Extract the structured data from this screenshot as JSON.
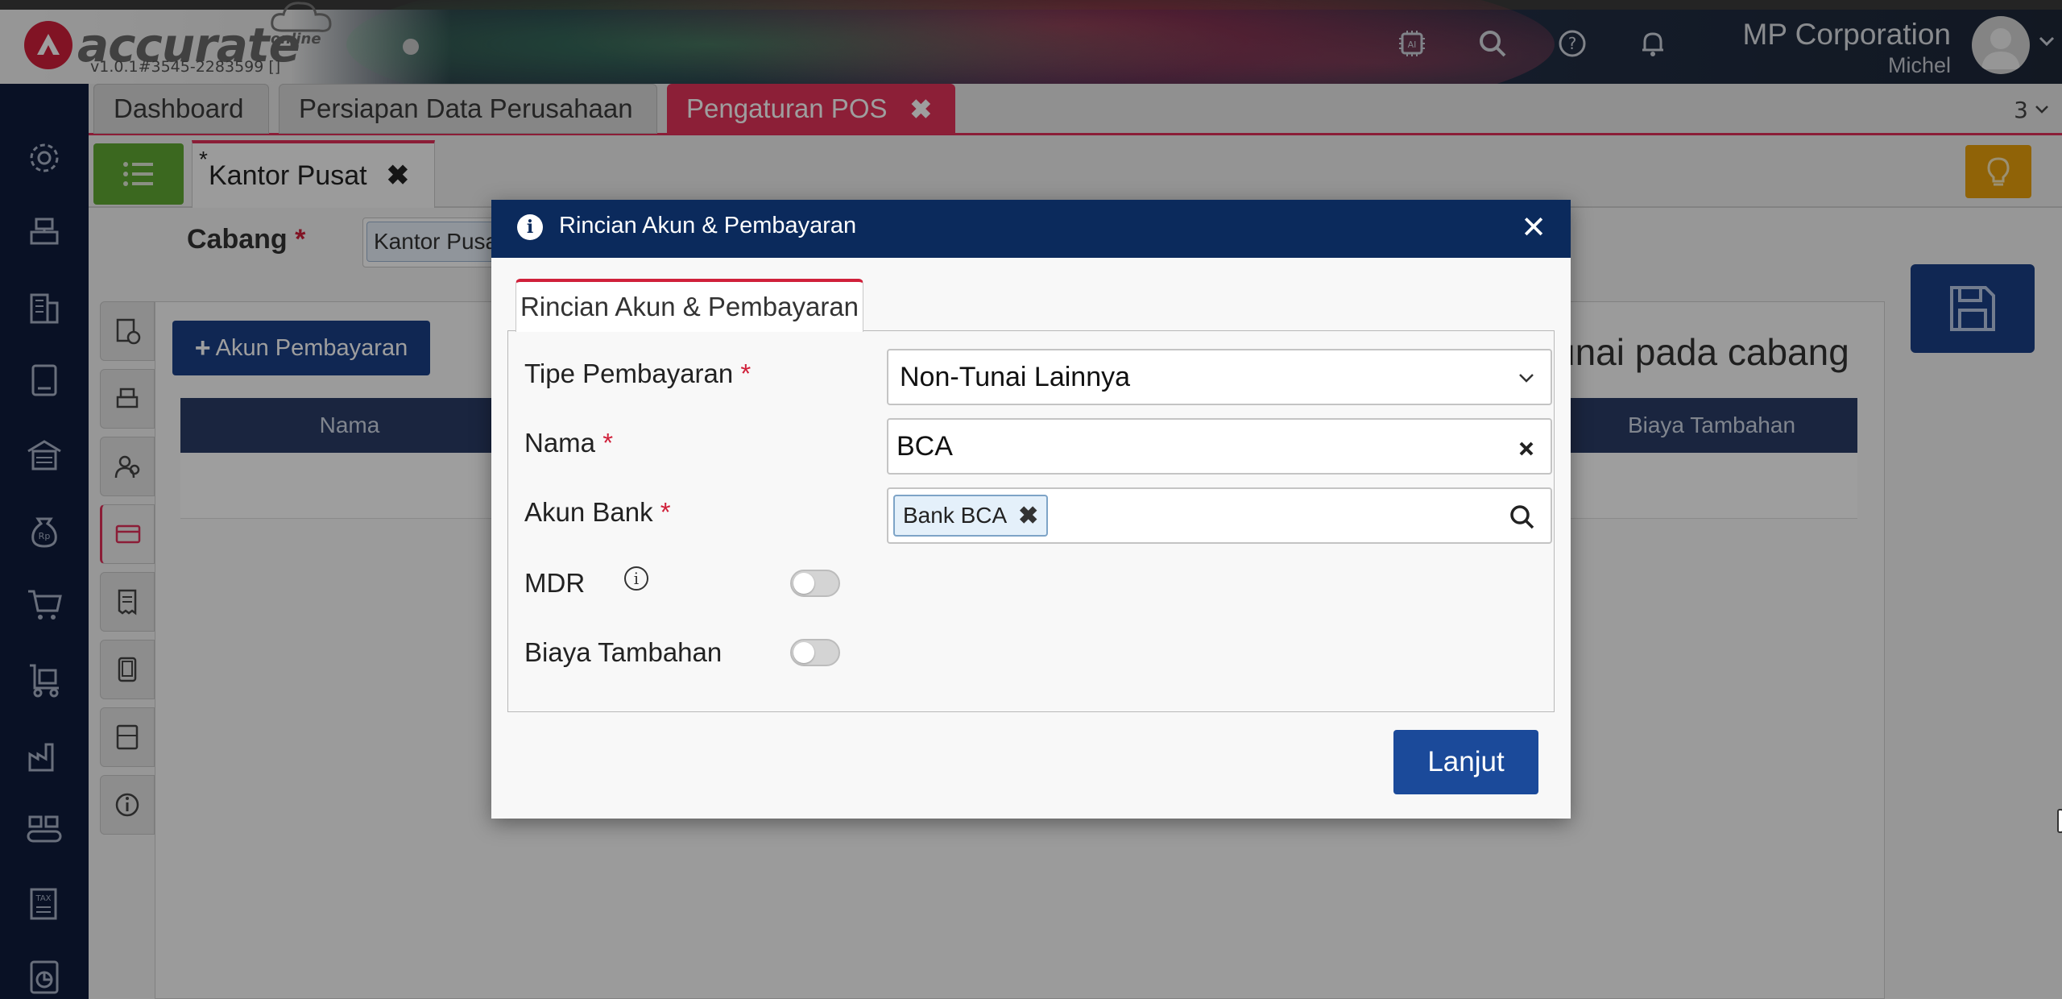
{
  "app": {
    "logo_text": "accurate",
    "logo_sub": "online",
    "version": "v1.0.1#3545-2283599 []",
    "company": "MP Corporation",
    "user": "Michel"
  },
  "tabs": [
    {
      "label": "Dashboard"
    },
    {
      "label": "Persiapan Data Perusahaan"
    },
    {
      "label": "Pengaturan POS",
      "close": "✖"
    }
  ],
  "tab_count": "3",
  "subtab": {
    "star": "*",
    "label": "Kantor Pusat",
    "close": "✖"
  },
  "form": {
    "cabang_label": "Cabang",
    "cabang_value": "Kantor Pusat",
    "required": "*"
  },
  "panel": {
    "add_button": "Akun Pembayaran",
    "add_plus": "+",
    "title_fragment": "unai pada cabang",
    "col_nama": "Nama",
    "col_biaya": "Biaya Tambahan"
  },
  "modal": {
    "title": "Rincian Akun & Pembayaran",
    "close": "✕",
    "info": "i",
    "tab_label": "Rincian Akun & Pembayaran",
    "fields": {
      "tipe_label": "Tipe Pembayaran",
      "tipe_value": "Non-Tunai Lainnya",
      "nama_label": "Nama",
      "nama_value": "BCA",
      "akun_label": "Akun Bank",
      "akun_chip": "Bank BCA",
      "chip_close": "✖",
      "mdr_label": "MDR",
      "mdr_info": "i",
      "biaya_label": "Biaya Tambahan",
      "required": "*"
    },
    "mdr_enabled": false,
    "biaya_enabled": false,
    "submit": "Lanjut"
  },
  "colors": {
    "sidebar": "#0f1c3c",
    "modal_header": "#0b2a5c",
    "primary_button": "#1b4a9a",
    "active_tab": "#e3335a",
    "menu_green": "#5fa832",
    "required": "#d0203a"
  },
  "icons": {
    "sidebar": [
      "gear-icon",
      "cash-register-icon",
      "building-icon",
      "book-icon",
      "warehouse-icon",
      "money-bag-icon",
      "cart-icon",
      "trolley-icon",
      "factory-icon",
      "conveyor-icon",
      "tax-icon",
      "report-icon"
    ],
    "vertical_tabs": [
      "document-clock-icon",
      "printer-icon",
      "users-icon",
      "card-icon",
      "receipt-icon",
      "tablet-icon",
      "calculator-icon",
      "info-icon"
    ]
  }
}
